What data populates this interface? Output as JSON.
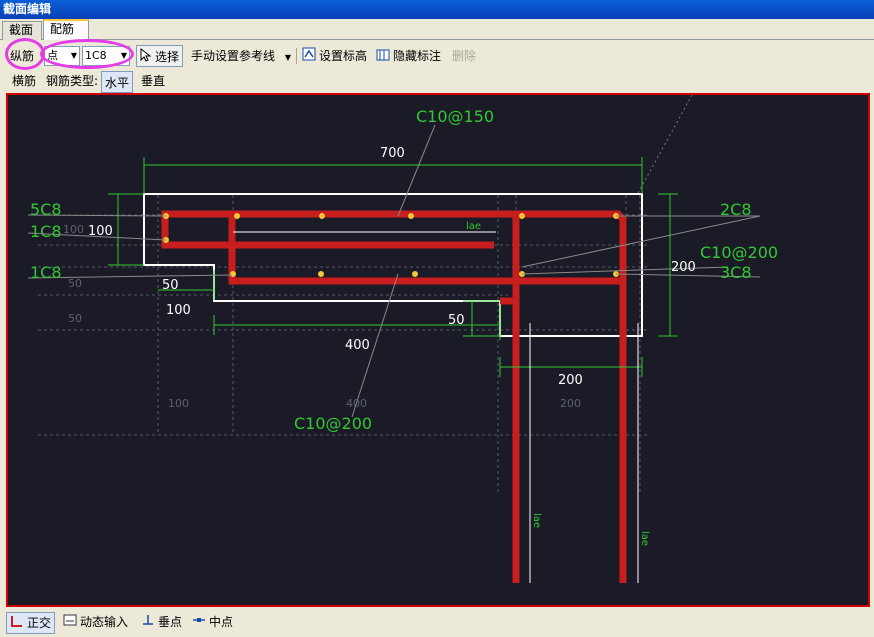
{
  "window": {
    "title": "截面编辑"
  },
  "tabs": [
    {
      "label": "截面"
    },
    {
      "label": "配筋"
    }
  ],
  "toolbar": {
    "bar_type": "纵筋",
    "point_mode": "点",
    "spec": "1C8",
    "select_label": "选择",
    "ref_line_label": "手动设置参考线",
    "elevation_label": "设置标高",
    "hide_label": "隐藏标注",
    "delete_label": "删除"
  },
  "toolbar2": {
    "cross_bar": "横筋",
    "type_label": "钢筋类型:",
    "horizontal": "水平",
    "vertical": "垂直"
  },
  "drawing": {
    "labels": {
      "top_stirrup": "C10@150",
      "bot_stirrup": "C10@200",
      "right_stirrup": "C10@200",
      "left_top": "5C8",
      "left_mid": "1C8",
      "left_bot": "1C8",
      "right_top": "2C8",
      "right_bot": "3C8"
    },
    "dims": {
      "d700": "700",
      "d100_left": "100",
      "d50_left": "50",
      "d100_under": "100",
      "d50_mid": "50",
      "d400": "400",
      "d200_right": "200",
      "d200_bottom": "200",
      "lae": "lae"
    },
    "grid_labels": {
      "g100a": "100",
      "g50a": "50",
      "g50b": "50",
      "g100b": "100",
      "g400": "400",
      "g200": "200"
    },
    "colors": {
      "background": "#1a1b26",
      "rebar": "#c81e1e",
      "outline": "#ffffff",
      "dimension": "#32c832",
      "point": "#f0c832",
      "frame": "#d40000"
    }
  },
  "statusbar": {
    "ortho": "正交",
    "dynamic_input": "动态输入",
    "perpendicular": "垂点",
    "midpoint": "中点"
  }
}
